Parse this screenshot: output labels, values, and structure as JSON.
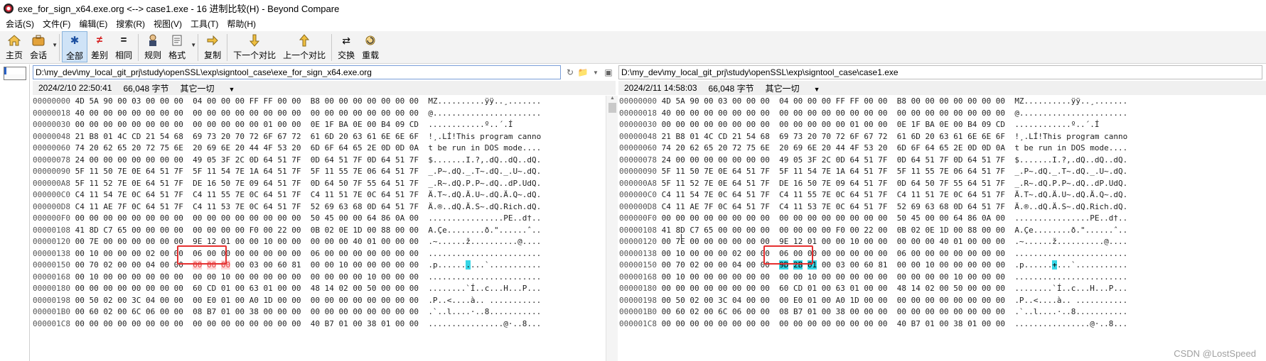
{
  "window": {
    "title": "exe_for_sign_x64.exe.org <--> case1.exe - 16 进制比较(H) - Beyond Compare"
  },
  "menu": [
    "会话(S)",
    "文件(F)",
    "编辑(E)",
    "搜索(R)",
    "视图(V)",
    "工具(T)",
    "帮助(H)"
  ],
  "toolbar": {
    "home": "主页",
    "session": "会话",
    "all": "全部",
    "diffs": "差别",
    "same": "相同",
    "rules": "规则",
    "format": "格式",
    "copy": "复制",
    "next_diff": "下一个对比",
    "prev_diff": "上一个对比",
    "swap": "交换",
    "reload": "重载"
  },
  "icons": {
    "home": "home-icon",
    "session": "briefcase-icon",
    "all": "asterisk-icon",
    "diffs": "not-equal-icon",
    "same": "equal-icon",
    "rules": "umpire-icon",
    "format": "document-format-icon",
    "copy": "copy-arrow-icon",
    "next": "arrow-down-icon",
    "prev": "arrow-up-icon",
    "swap": "swap-icon",
    "reload": "reload-icon"
  },
  "left": {
    "path": "D:\\my_dev\\my_local_git_prj\\study\\openSSL\\exp\\signtool_case\\exe_for_sign_x64.exe.org",
    "date": "2024/2/10 22:50:41",
    "size": "66,048 字节",
    "encoding": "其它一切",
    "rows": [
      [
        "00000000",
        "4D 5A 90 00 03 00 00 00  04 00 00 00 FF FF 00 00  B8 00 00 00 00 00 00 00",
        "MZ..........ÿÿ..¸......."
      ],
      [
        "00000018",
        "40 00 00 00 00 00 00 00  00 00 00 00 00 00 00 00  00 00 00 00 00 00 00 00",
        "@......................."
      ],
      [
        "00000030",
        "00 00 00 00 00 00 00 00  00 00 00 00 00 01 00 00  0E 1F BA 0E 00 B4 09 CD",
        "............º..´.Í"
      ],
      [
        "00000048",
        "21 B8 01 4C CD 21 54 68  69 73 20 70 72 6F 67 72  61 6D 20 63 61 6E 6E 6F",
        "!¸.LÍ!This program canno"
      ],
      [
        "00000060",
        "74 20 62 65 20 72 75 6E  20 69 6E 20 44 4F 53 20  6D 6F 64 65 2E 0D 0D 0A",
        "t be run in DOS mode...."
      ],
      [
        "00000078",
        "24 00 00 00 00 00 00 00  49 05 3F 2C 0D 64 51 7F  0D 64 51 7F 0D 64 51 7F",
        "$.......I.?,.dQ..dQ..dQ."
      ],
      [
        "00000090",
        "5F 11 50 7E 0E 64 51 7F  5F 11 54 7E 1A 64 51 7F  5F 11 55 7E 06 64 51 7F",
        "_.P~.dQ._.T~.dQ._.U~.dQ."
      ],
      [
        "000000A8",
        "5F 11 52 7E 0E 64 51 7F  DE 16 50 7E 09 64 51 7F  0D 64 50 7F 55 64 51 7F",
        "_.R~.dQ.P.P~.dQ..dP.UdQ."
      ],
      [
        "000000C0",
        "C4 11 54 7E 0C 64 51 7F  C4 11 55 7E 0C 64 51 7F  C4 11 51 7E 0C 64 51 7F",
        "Ä.T~.dQ.Ä.U~.dQ.Ä.Q~.dQ."
      ],
      [
        "000000D8",
        "C4 11 AE 7F 0C 64 51 7F  C4 11 53 7E 0C 64 51 7F  52 69 63 68 0D 64 51 7F",
        "Ä.®..dQ.Ä.S~.dQ.Rich.dQ."
      ],
      [
        "000000F0",
        "00 00 00 00 00 00 00 00  00 00 00 00 00 00 00 00  50 45 00 00 64 86 0A 00",
        "................PE..d†.."
      ],
      [
        "00000108",
        "41 8D C7 65 00 00 00 00  00 00 00 00 F0 00 22 00  0B 02 0E 1D 00 88 00 00",
        "A.Çe........ð.\"......ˆ.."
      ],
      [
        "00000120",
        "00 7E 00 00 00 00 00 00  9E 12 01 00 00 10 00 00  00 00 00 40 01 00 00 00",
        ".~......ž..........@...."
      ],
      [
        "00000138",
        "00 10 00 00 00 02 00 00  06 00 00 00 00 00 00 00  06 00 00 00 00 00 00 00",
        "........................"
      ],
      [
        "00000150",
        "00 70 02 00 00 04 00 00  00 00 00 00 03 00 60 81  00 00 10 00 00 00 00 00",
        ".p..........`..........."
      ],
      [
        "00000168",
        "00 10 00 00 00 00 00 00  00 00 10 00 00 00 00 00  00 00 00 00 10 00 00 00",
        "........................"
      ],
      [
        "00000180",
        "00 00 00 00 00 00 00 00  60 CD 01 00 63 01 00 00  48 14 02 00 50 00 00 00",
        "........`Í..c...H...P..."
      ],
      [
        "00000198",
        "00 50 02 00 3C 04 00 00  00 E0 01 00 A0 1D 00 00  00 00 00 00 00 00 00 00",
        ".P..<....à.. ..........."
      ],
      [
        "000001B0",
        "00 60 02 00 6C 06 00 00  08 B7 01 00 38 00 00 00  00 00 00 00 00 00 00 00",
        ".`..l....·..8..........."
      ],
      [
        "000001C8",
        "00 00 00 00 00 00 00 00  00 00 00 00 00 00 00 00  40 B7 01 00 38 01 00 00",
        "................@·..8..."
      ]
    ]
  },
  "right": {
    "path": "D:\\my_dev\\my_local_git_prj\\study\\openSSL\\exp\\signtool_case\\case1.exe",
    "date": "2024/2/11 14:58:03",
    "size": "66,048 字节",
    "encoding": "其它一切",
    "rows": [
      [
        "00000000",
        "4D 5A 90 00 03 00 00 00  04 00 00 00 FF FF 00 00  B8 00 00 00 00 00 00 00",
        "MZ..........ÿÿ..¸......."
      ],
      [
        "00000018",
        "40 00 00 00 00 00 00 00  00 00 00 00 00 00 00 00  00 00 00 00 00 00 00 00",
        "@......................."
      ],
      [
        "00000030",
        "00 00 00 00 00 00 00 00  00 00 00 00 00 01 00 00  0E 1F BA 0E 00 B4 09 CD",
        "............º..´.Í"
      ],
      [
        "00000048",
        "21 B8 01 4C CD 21 54 68  69 73 20 70 72 6F 67 72  61 6D 20 63 61 6E 6E 6F",
        "!¸.LÍ!This program canno"
      ],
      [
        "00000060",
        "74 20 62 65 20 72 75 6E  20 69 6E 20 44 4F 53 20  6D 6F 64 65 2E 0D 0D 0A",
        "t be run in DOS mode...."
      ],
      [
        "00000078",
        "24 00 00 00 00 00 00 00  49 05 3F 2C 0D 64 51 7F  0D 64 51 7F 0D 64 51 7F",
        "$.......I.?,.dQ..dQ..dQ."
      ],
      [
        "00000090",
        "5F 11 50 7E 0E 64 51 7F  5F 11 54 7E 1A 64 51 7F  5F 11 55 7E 06 64 51 7F",
        "_.P~.dQ._.T~.dQ._.U~.dQ."
      ],
      [
        "000000A8",
        "5F 11 52 7E 0E 64 51 7F  DE 16 50 7E 09 64 51 7F  0D 64 50 7F 55 64 51 7F",
        "_.R~.dQ.P.P~.dQ..dP.UdQ."
      ],
      [
        "000000C0",
        "C4 11 54 7E 0C 64 51 7F  C4 11 55 7E 0C 64 51 7F  C4 11 51 7E 0C 64 51 7F",
        "Ä.T~.dQ.Ä.U~.dQ.Ä.Q~.dQ."
      ],
      [
        "000000D8",
        "C4 11 AE 7F 0C 64 51 7F  C4 11 53 7E 0C 64 51 7F  52 69 63 68 0D 64 51 7F",
        "Ä.®..dQ.Ä.S~.dQ.Rich.dQ."
      ],
      [
        "000000F0",
        "00 00 00 00 00 00 00 00  00 00 00 00 00 00 00 00  50 45 00 00 64 86 0A 00",
        "................PE..d†.."
      ],
      [
        "00000108",
        "41 8D C7 65 00 00 00 00  00 00 00 00 F0 00 22 00  0B 02 0E 1D 00 88 00 00",
        "A.Çe........ð.\"......ˆ.."
      ],
      [
        "00000120",
        "00 7E 00 00 00 00 00 00  9E 12 01 00 00 10 00 00  00 00 00 40 01 00 00 00",
        ".~......ž..........@...."
      ],
      [
        "00000138",
        "00 10 00 00 00 02 00 00  06 00 00 00 00 00 00 00  06 00 00 00 00 00 00 00",
        "........................"
      ],
      [
        "00000150",
        "00 70 02 00 00 04 00 00  9D 2B 01 00 03 00 60 81  00 00 10 00 00 00 00 00",
        ".p......+...`..........."
      ],
      [
        "00000168",
        "00 10 00 00 00 00 00 00  00 00 10 00 00 00 00 00  00 00 00 00 10 00 00 00",
        "........................"
      ],
      [
        "00000180",
        "00 00 00 00 00 00 00 00  60 CD 01 00 63 01 00 00  48 14 02 00 50 00 00 00",
        "........`Í..c...H...P..."
      ],
      [
        "00000198",
        "00 50 02 00 3C 04 00 00  00 E0 01 00 A0 1D 00 00  00 00 00 00 00 00 00 00",
        ".P..<....à.. ..........."
      ],
      [
        "000001B0",
        "00 60 02 00 6C 06 00 00  08 B7 01 00 38 00 00 00  00 00 00 00 00 00 00 00",
        ".`..l....·..8..........."
      ],
      [
        "000001C8",
        "00 00 00 00 00 00 00 00  00 00 00 00 00 00 00 00  40 B7 01 00 38 01 00 00",
        "................@·..8..."
      ]
    ]
  },
  "watermark": "CSDN @LostSpeed"
}
